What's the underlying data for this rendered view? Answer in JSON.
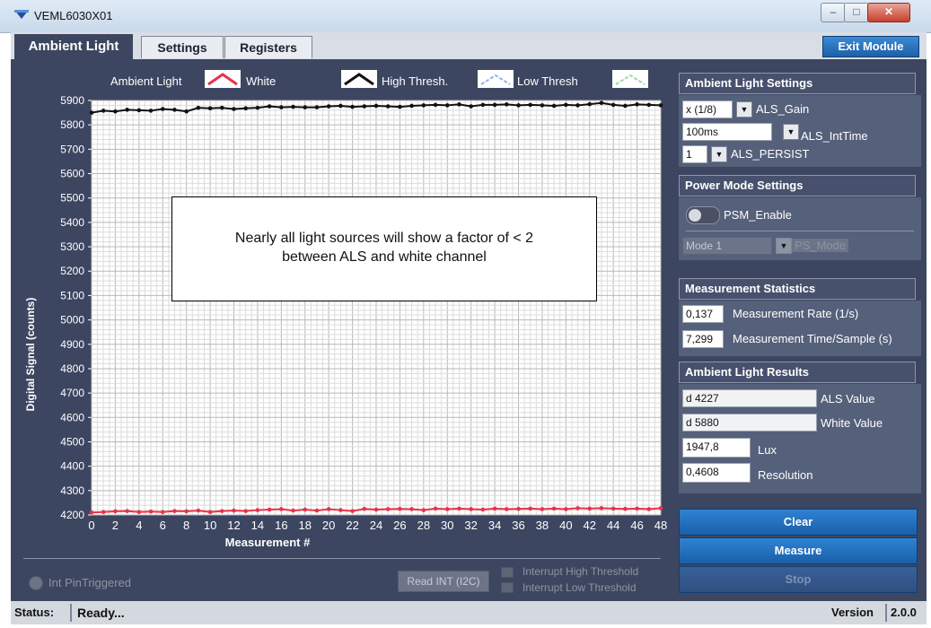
{
  "window": {
    "title": "VEML6030X01",
    "min_icon": "minimize-icon",
    "max_icon": "maximize-icon",
    "close_icon": "close-icon"
  },
  "tabs": [
    {
      "label": "Ambient Light",
      "active": true
    },
    {
      "label": "Settings",
      "active": false
    },
    {
      "label": "Registers",
      "active": false
    }
  ],
  "exit_label": "Exit Module",
  "legend": {
    "ambient": "Ambient Light",
    "white": "White",
    "high": "High Thresh.",
    "low": "Low Thresh"
  },
  "annotation": {
    "line1": "Nearly all light sources will show a factor of < 2",
    "line2": "between ALS and white channel"
  },
  "chart_data": {
    "type": "line",
    "xlabel": "Measurement #",
    "ylabel": "Digital Signal (counts)",
    "xlim": [
      0,
      48
    ],
    "ylim": [
      4200,
      5900
    ],
    "xticks": [
      0,
      2,
      4,
      6,
      8,
      10,
      12,
      14,
      16,
      18,
      20,
      22,
      24,
      26,
      28,
      30,
      32,
      34,
      36,
      38,
      40,
      42,
      44,
      46,
      48
    ],
    "yticks": [
      4200,
      4300,
      4400,
      4500,
      4600,
      4700,
      4800,
      4900,
      5000,
      5100,
      5200,
      5300,
      5400,
      5500,
      5600,
      5700,
      5800,
      5900
    ],
    "grid": true,
    "series": [
      {
        "name": "White",
        "color": "#111111",
        "values": [
          5850,
          5858,
          5855,
          5862,
          5860,
          5858,
          5865,
          5862,
          5855,
          5870,
          5868,
          5870,
          5865,
          5868,
          5870,
          5876,
          5872,
          5874,
          5872,
          5872,
          5876,
          5878,
          5874,
          5876,
          5878,
          5876,
          5874,
          5878,
          5880,
          5882,
          5880,
          5884,
          5876,
          5882,
          5882,
          5884,
          5880,
          5882,
          5880,
          5878,
          5882,
          5880,
          5885,
          5890,
          5882,
          5878,
          5884,
          5882,
          5880
        ]
      },
      {
        "name": "Ambient Light",
        "color": "#e8334a",
        "values": [
          4210,
          4212,
          4215,
          4216,
          4212,
          4214,
          4212,
          4216,
          4215,
          4218,
          4212,
          4216,
          4218,
          4216,
          4220,
          4222,
          4224,
          4218,
          4222,
          4218,
          4224,
          4220,
          4216,
          4225,
          4222,
          4224,
          4225,
          4224,
          4220,
          4226,
          4224,
          4226,
          4224,
          4222,
          4226,
          4224,
          4225,
          4226,
          4224,
          4226,
          4224,
          4228,
          4226,
          4228,
          4226,
          4225,
          4226,
          4224,
          4228
        ]
      }
    ]
  },
  "bottom": {
    "int_label": "Int PinTriggered",
    "read_label": "Read INT (I2C)",
    "int_high": "Interrupt High Threshold",
    "int_low": "Interrupt Low Threshold"
  },
  "als_settings": {
    "header": "Ambient Light Settings",
    "gain_value": "x (1/8)",
    "gain_label": "ALS_Gain",
    "inttime_value": "100ms",
    "inttime_label": "ALS_IntTime",
    "persist_value": "1",
    "persist_label": "ALS_PERSIST"
  },
  "power": {
    "header": "Power Mode Settings",
    "psm_label": "PSM_Enable",
    "mode_value": "Mode 1",
    "mode_label": "PS_Mode"
  },
  "stats": {
    "header": "Measurement Statistics",
    "rate_value": "0,137",
    "rate_label": "Measurement Rate (1/s)",
    "time_value": "7,299",
    "time_label": "Measurement Time/Sample (s)"
  },
  "results": {
    "header": "Ambient Light Results",
    "als_value": "d 4227",
    "als_label": "ALS Value",
    "white_value": "d 5880",
    "white_label": "White Value",
    "lux_value": "1947,8",
    "lux_label": "Lux",
    "res_value": "0,4608",
    "res_label": "Resolution"
  },
  "buttons": {
    "clear": "Clear",
    "measure": "Measure",
    "stop": "Stop"
  },
  "status": {
    "label": "Status:",
    "value": "Ready...",
    "version_label": "Version",
    "version_value": "2.0.0"
  }
}
